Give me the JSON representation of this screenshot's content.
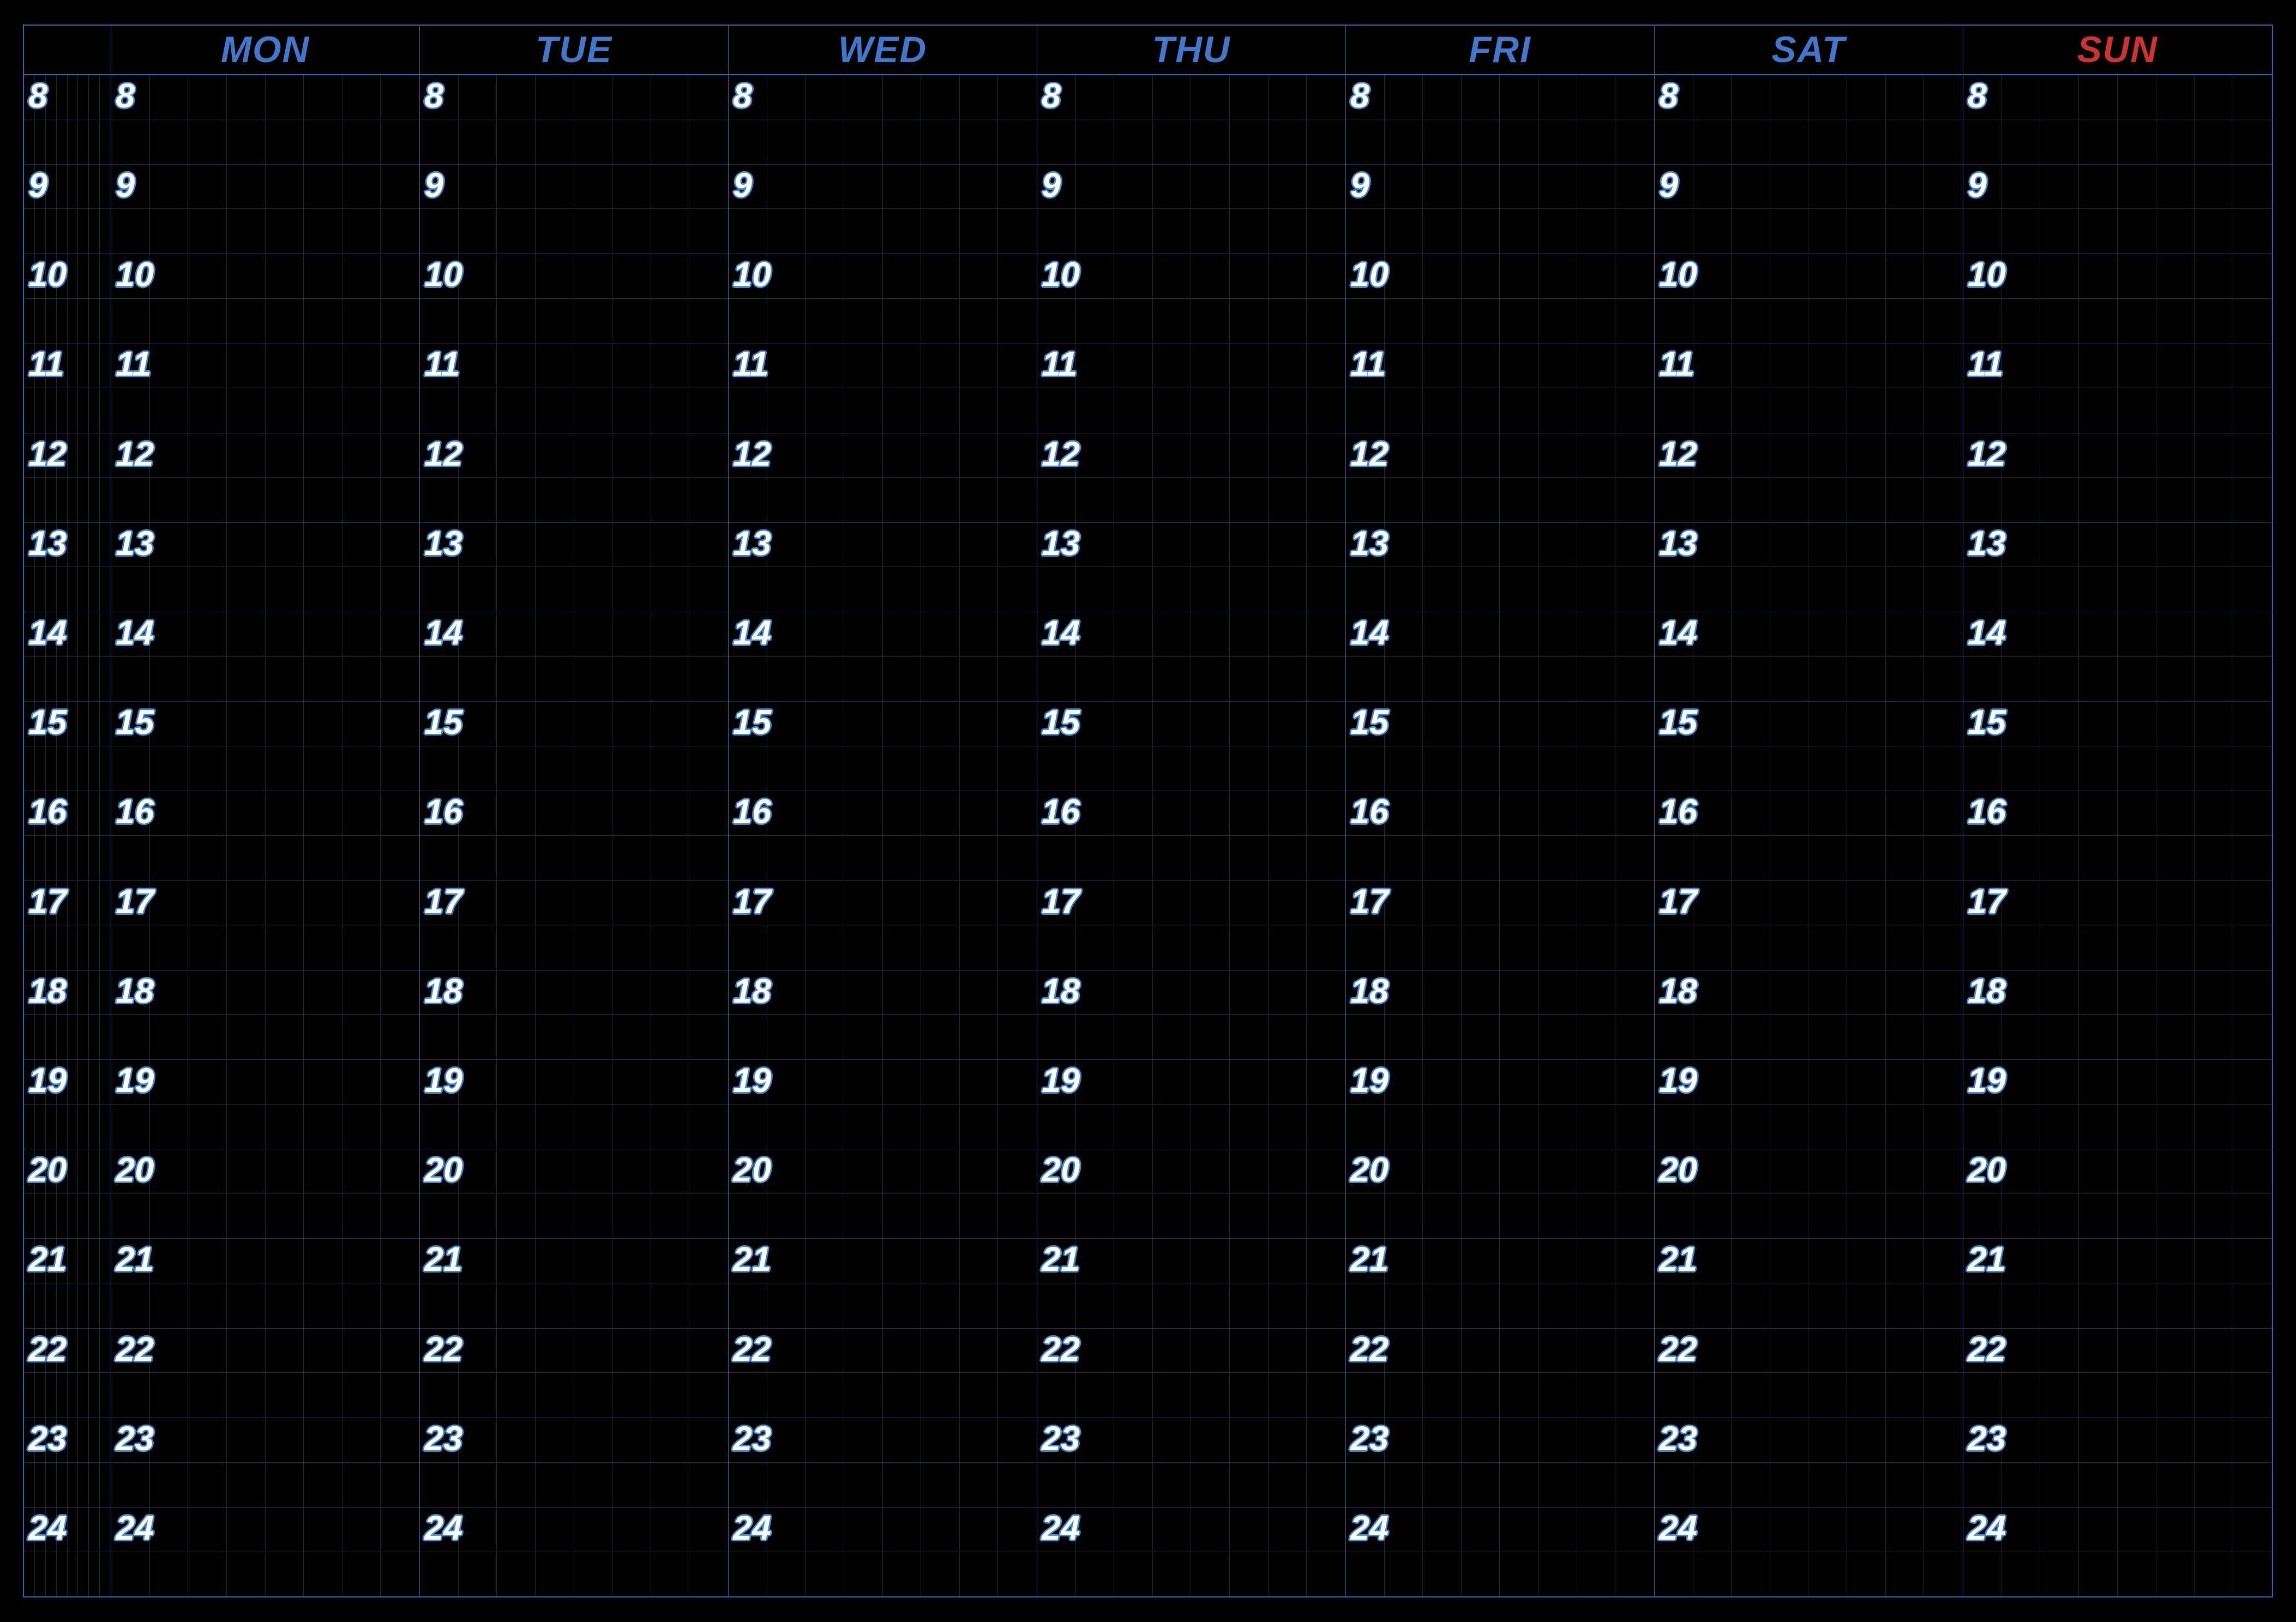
{
  "calendar": {
    "days": [
      {
        "label": "MON",
        "color": "blue"
      },
      {
        "label": "TUE",
        "color": "blue"
      },
      {
        "label": "WED",
        "color": "blue"
      },
      {
        "label": "THU",
        "color": "blue"
      },
      {
        "label": "FRI",
        "color": "blue"
      },
      {
        "label": "SAT",
        "color": "blue"
      },
      {
        "label": "SUN",
        "color": "red"
      }
    ],
    "hours": [
      8,
      9,
      10,
      11,
      12,
      13,
      14,
      15,
      16,
      17,
      18,
      19,
      20,
      21,
      22,
      23,
      24
    ]
  }
}
